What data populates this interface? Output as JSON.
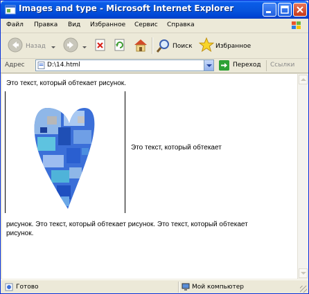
{
  "window": {
    "title": "Images and type - Microsoft Internet Explorer"
  },
  "menu": {
    "items": [
      "Файл",
      "Правка",
      "Вид",
      "Избранное",
      "Сервис",
      "Справка"
    ]
  },
  "toolbar": {
    "back_label": "Назад",
    "search_label": "Поиск",
    "favorites_label": "Избранное"
  },
  "address": {
    "label": "Адрес",
    "value": "D:\\14.html",
    "go_label": "Переход",
    "links_label": "Ссылки"
  },
  "page": {
    "line1": "Это текст, который обтекает рисунок.",
    "beside_image": "Это текст, который обтекает",
    "after_image_line1": "рисунок. Это текст, который обтекает рисунок. Это текст, который обтекает",
    "after_image_line2": "рисунок."
  },
  "status": {
    "left_text": "Готово",
    "zone_text": "Мой компьютер"
  },
  "colors": {
    "titlebar": "#0855dd",
    "chrome": "#ece9d8",
    "heart_primary": "#3b6fd8",
    "heart_secondary": "#8fb7e8"
  },
  "icons": [
    "ie-icon",
    "minimize-icon",
    "maximize-icon",
    "close-icon",
    "windows-flag-icon",
    "back-icon",
    "forward-icon",
    "stop-icon",
    "refresh-icon",
    "home-icon",
    "search-icon",
    "favorites-star-icon",
    "page-icon",
    "go-arrow-icon",
    "computer-icon",
    "heart-image"
  ]
}
